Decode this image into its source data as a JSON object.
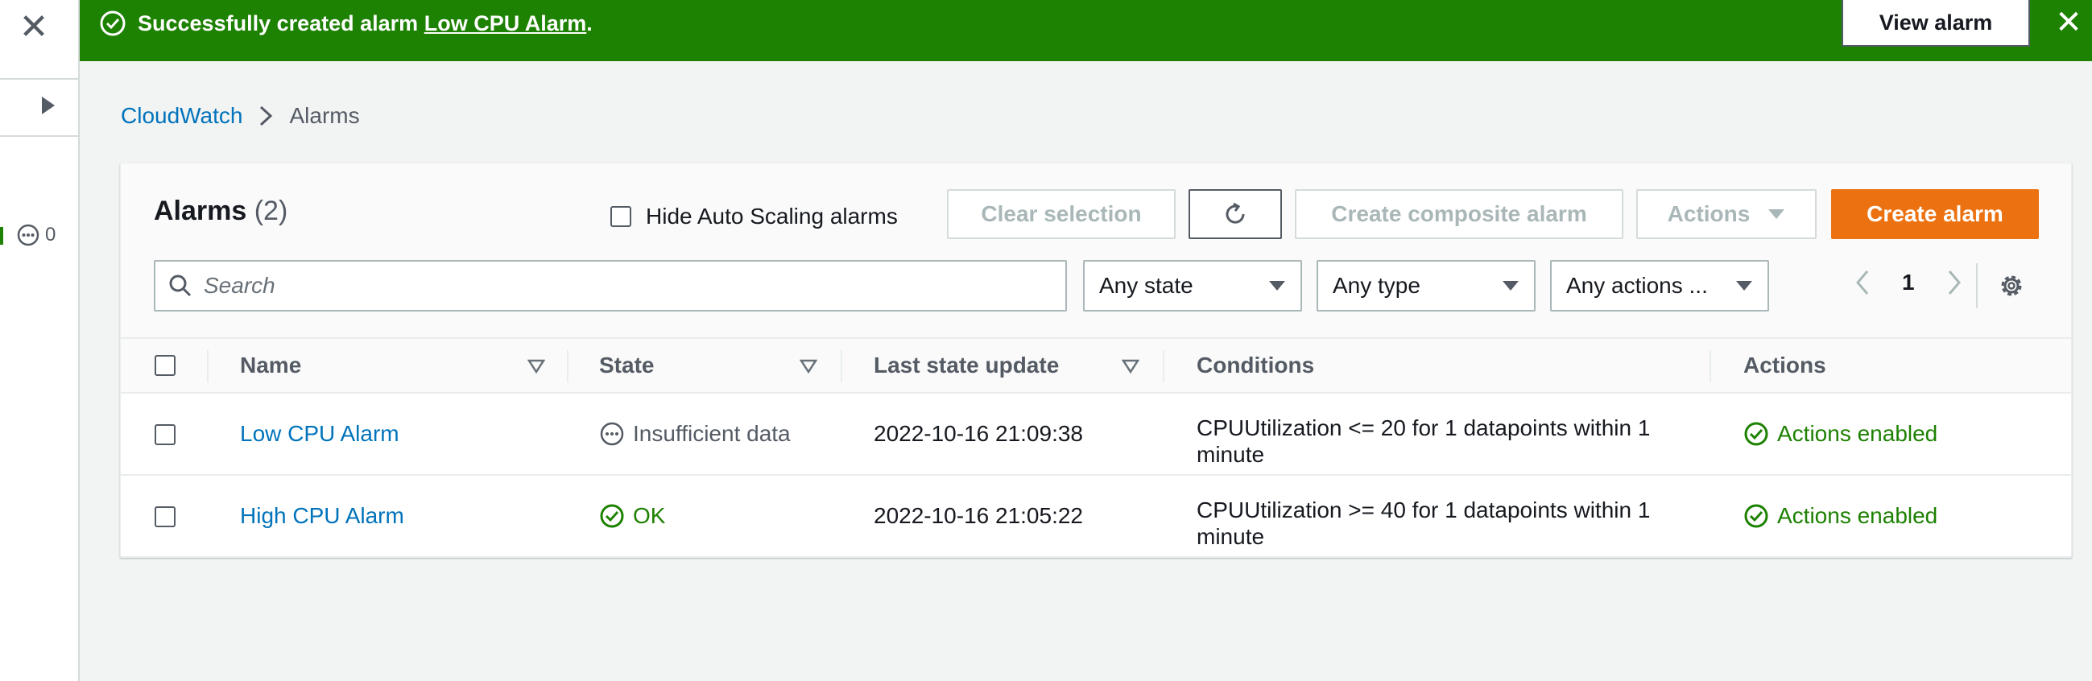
{
  "banner": {
    "message_prefix": "Successfully created alarm",
    "alarm_link": "Low CPU Alarm",
    "message_suffix": ".",
    "view_button": "View alarm"
  },
  "leftnav": {
    "pending_count": "0"
  },
  "breadcrumb": {
    "root": "CloudWatch",
    "current": "Alarms"
  },
  "panel": {
    "title": "Alarms",
    "count": "(2)",
    "hide_autoscaling_label": "Hide Auto Scaling alarms",
    "clear_selection": "Clear selection",
    "create_composite": "Create composite alarm",
    "actions": "Actions",
    "create_alarm": "Create alarm",
    "search_placeholder": "Search",
    "filters": {
      "state": "Any state",
      "type": "Any type",
      "actions": "Any actions ..."
    },
    "page": "1"
  },
  "table": {
    "columns": [
      "Name",
      "State",
      "Last state update",
      "Conditions",
      "Actions"
    ],
    "rows": [
      {
        "name": "Low CPU Alarm",
        "state": "Insufficient data",
        "last_update": "2022-10-16 21:09:38",
        "conditions": "CPUUtilization <= 20 for 1 datapoints within 1 minute",
        "actions": "Actions enabled"
      },
      {
        "name": "High CPU Alarm",
        "state": "OK",
        "last_update": "2022-10-16 21:05:22",
        "conditions": "CPUUtilization >= 40 for 1 datapoints within 1 minute",
        "actions": "Actions enabled"
      }
    ]
  },
  "colors": {
    "success": "#1d8102",
    "link": "#0073bb",
    "primary": "#ec7211"
  }
}
